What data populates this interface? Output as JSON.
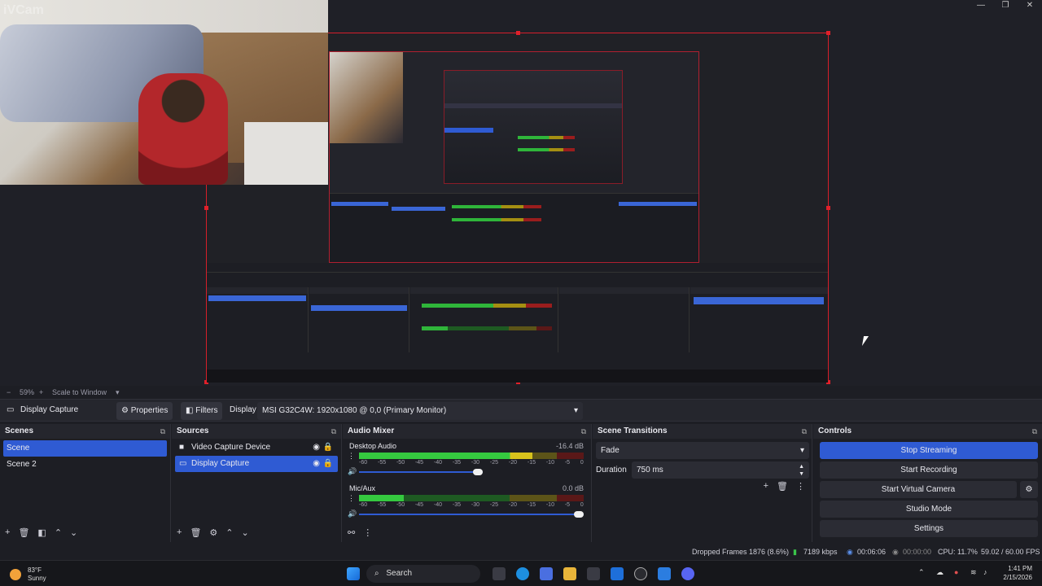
{
  "window": {
    "controls": [
      "—",
      "❐",
      "✕"
    ]
  },
  "webcam": {
    "label": "iVCam"
  },
  "zoom": {
    "percent": "59%",
    "scale_mode": "Scale to Window"
  },
  "source_toolbar": {
    "source_name": "Display Capture",
    "properties_label": "Properties",
    "filters_label": "Filters",
    "display_label": "Display",
    "display_value": "MSI G32C4W: 1920x1080 @ 0,0 (Primary Monitor)"
  },
  "scenes": {
    "title": "Scenes",
    "items": [
      {
        "label": "Scene",
        "selected": true
      },
      {
        "label": "Scene 2",
        "selected": false
      }
    ]
  },
  "sources": {
    "title": "Sources",
    "items": [
      {
        "label": "Video Capture Device",
        "selected": false
      },
      {
        "label": "Display Capture",
        "selected": true
      }
    ]
  },
  "audio_mixer": {
    "title": "Audio Mixer",
    "channels": [
      {
        "name": "Desktop Audio",
        "db": "-16.4 dB",
        "level": 0.77,
        "volume": 0.55
      },
      {
        "name": "Mic/Aux",
        "db": "0.0 dB",
        "level": 0.2,
        "volume": 1.0
      }
    ],
    "scale": [
      "-60",
      "-55",
      "-50",
      "-45",
      "-40",
      "-35",
      "-30",
      "-25",
      "-20",
      "-15",
      "-10",
      "-5",
      "0"
    ]
  },
  "scene_transitions": {
    "title": "Scene Transitions",
    "transition": "Fade",
    "duration_label": "Duration",
    "duration_value": "750 ms"
  },
  "controls": {
    "title": "Controls",
    "stop_streaming": "Stop Streaming",
    "start_recording": "Start Recording",
    "start_virtual_camera": "Start Virtual Camera",
    "studio_mode": "Studio Mode",
    "settings": "Settings"
  },
  "status": {
    "dropped_frames": "Dropped Frames 1876 (8.6%)",
    "bitrate": "7189 kbps",
    "stream_time": "00:06:06",
    "rec_time": "00:00:00",
    "cpu": "CPU: 11.7%",
    "fps": "59.02 / 60.00 FPS"
  },
  "taskbar": {
    "weather_temp": "83°F",
    "weather_desc": "Sunny",
    "search_placeholder": "Search",
    "time": "1:41 PM",
    "date": "2/15/2026"
  },
  "colors": {
    "accent": "#2f5bd3",
    "frame_red": "#d61f2a",
    "background": "#1d1e24",
    "panel": "#25262d"
  }
}
